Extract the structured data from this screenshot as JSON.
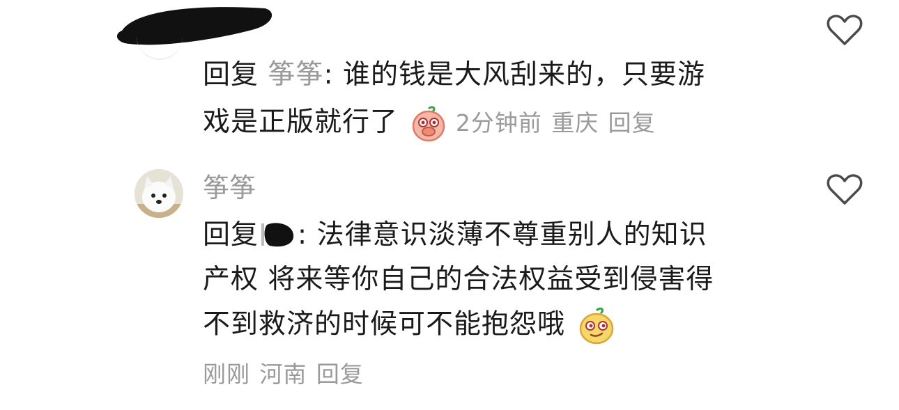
{
  "comment1": {
    "reply_prefix": "回复",
    "reply_to": "筝筝",
    "colon": ":",
    "line1_text": "谁的钱是大风刮来的，只要游",
    "line2_text": "戏是正版就行了",
    "time": "2分钟前",
    "location": "重庆",
    "reply_action": "回复",
    "emoji": "covering-mouth-emoji"
  },
  "comment2": {
    "username": "筝筝",
    "reply_prefix": "回复",
    "colon": ":",
    "line1_text": "法律意识淡薄不尊重别人的知识",
    "line2_text": "产权 将来等你自己的合法权益受到侵害得",
    "line3_text": "不到救济的时候可不能抱怨哦",
    "time": "刚刚",
    "location": "河南",
    "reply_action": "回复",
    "emoji": "smirk-emoji"
  },
  "icons": {
    "like": "heart-outline-icon"
  },
  "colors": {
    "text": "#1a1a1a",
    "meta": "#9a9a9a",
    "icon": "#4a4a4a"
  }
}
